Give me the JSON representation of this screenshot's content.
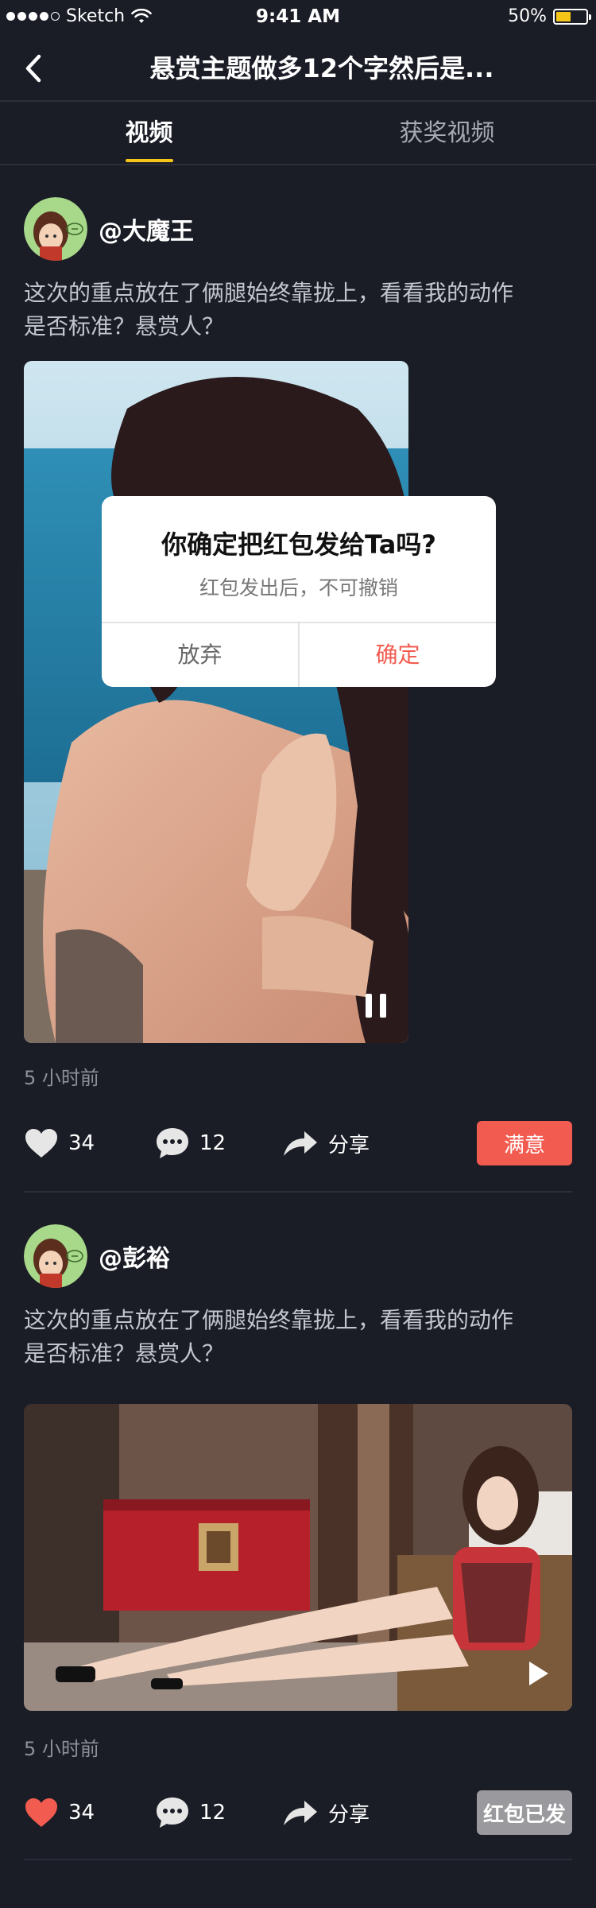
{
  "status_bar": {
    "carrier": "Sketch",
    "time": "9:41 AM",
    "battery": "50%",
    "battery_level": 0.5
  },
  "nav": {
    "title": "悬赏主题做多12个字然后是..."
  },
  "tabs": [
    {
      "label": "视频",
      "active": true
    },
    {
      "label": "获奖视频",
      "active": false
    }
  ],
  "posts": [
    {
      "username": "@大魔王",
      "text": "这次的重点放在了俩腿始终靠拢上，看看我的动作是否标准？悬赏人？",
      "timestamp": "5 小时前",
      "likes": "34",
      "liked": false,
      "comments": "12",
      "share_label": "分享",
      "status_label": "满意",
      "media_state": "playing"
    },
    {
      "username": "@彭裕",
      "text": "这次的重点放在了俩腿始终靠拢上，看看我的动作是否标准？悬赏人？",
      "timestamp": "5 小时前",
      "likes": "34",
      "liked": true,
      "comments": "12",
      "share_label": "分享",
      "status_label": "红包已发",
      "media_state": "paused"
    }
  ],
  "dialog": {
    "title": "你确定把红包发给Ta吗?",
    "subtitle": "红包发出后，不可撤销",
    "cancel_label": "放弃",
    "confirm_label": "确定"
  },
  "colors": {
    "background": "#1a1c26",
    "accent_yellow": "#f5c518",
    "accent_red": "#f25b4f",
    "muted_text": "#8e909a"
  },
  "icons": {
    "back": "chevron-left-icon",
    "like": "heart-icon",
    "comment": "speech-bubble-icon",
    "share": "share-arrow-icon",
    "pause": "pause-icon",
    "play": "play-icon"
  }
}
